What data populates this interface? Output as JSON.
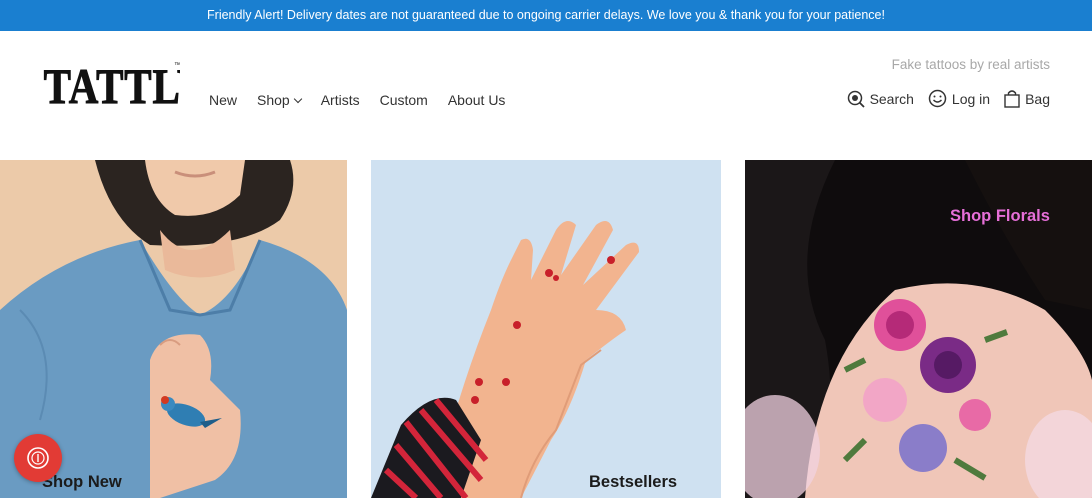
{
  "alert": {
    "text": "Friendly Alert! Delivery dates are not guaranteed due to ongoing carrier delays. We love you & thank you for your patience!"
  },
  "brand": {
    "logo_text": "TATTLY",
    "tagline": "Fake tattoos by real artists"
  },
  "nav": {
    "items": [
      {
        "label": "New"
      },
      {
        "label": "Shop",
        "has_dropdown": true
      },
      {
        "label": "Artists"
      },
      {
        "label": "Custom"
      },
      {
        "label": "About Us"
      }
    ]
  },
  "utilities": {
    "search": "Search",
    "login": "Log in",
    "bag": "Bag"
  },
  "tiles": [
    {
      "label": "Shop New",
      "label_color": "#1b1b1b"
    },
    {
      "label": "Bestsellers",
      "label_color": "#1b1b1b"
    },
    {
      "label": "Shop Florals",
      "label_color": "#e66fd8"
    }
  ],
  "colors": {
    "alert_bg": "#1a7fd0",
    "chat_button": "#e23b35",
    "florals_accent": "#e66fd8"
  }
}
